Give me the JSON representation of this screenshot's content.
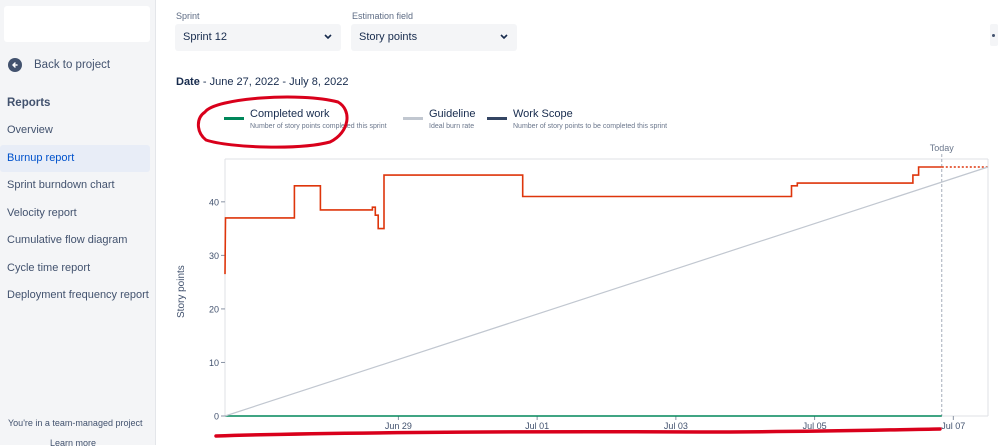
{
  "sidebar": {
    "back_label": "Back to project",
    "heading": "Reports",
    "items": [
      {
        "label": "Overview"
      },
      {
        "label": "Burnup report"
      },
      {
        "label": "Sprint burndown chart"
      },
      {
        "label": "Velocity report"
      },
      {
        "label": "Cumulative flow diagram"
      },
      {
        "label": "Cycle time report"
      },
      {
        "label": "Deployment frequency report"
      }
    ],
    "active_item": "Burnup report",
    "footer_line1": "You're in a team-managed project",
    "footer_line2": "Learn more"
  },
  "filters": {
    "sprint_label": "Sprint",
    "sprint_value": "Sprint 12",
    "estimation_label": "Estimation field",
    "estimation_value": "Story points"
  },
  "date": {
    "label": "Date",
    "range": " - June 27, 2022 - July 8, 2022"
  },
  "legend": [
    {
      "title": "Completed work",
      "description": "Number of story points completed this sprint",
      "color": "#00875a"
    },
    {
      "title": "Guideline",
      "description": "Ideal burn rate",
      "color": "#c1c7d0"
    },
    {
      "title": "Work Scope",
      "description": "Number of story points to be completed this sprint",
      "color": "#344563"
    }
  ],
  "annotation_color": "#d9001b",
  "chart_data": {
    "type": "line",
    "ylabel": "Story points",
    "ylim": [
      0,
      48
    ],
    "yticks": [
      0,
      10,
      20,
      30,
      40
    ],
    "xlim": [
      "2022-06-27",
      "2022-07-08"
    ],
    "xticks": [
      "Jun 29",
      "Jul 01",
      "Jul 03",
      "Jul 05",
      "Jul 07"
    ],
    "today_label": "Today",
    "today_date": "2022-07-07",
    "series": [
      {
        "name": "Work Scope",
        "color": "#de350b",
        "points": [
          [
            "2022-06-27T00:00",
            26.5
          ],
          [
            "2022-06-27T00:10",
            37
          ],
          [
            "2022-06-28T00:00",
            37
          ],
          [
            "2022-06-28T00:00",
            43
          ],
          [
            "2022-06-28T09:00",
            43
          ],
          [
            "2022-06-28T09:00",
            38.5
          ],
          [
            "2022-06-29T03:00",
            38.5
          ],
          [
            "2022-06-29T03:00",
            39
          ],
          [
            "2022-06-29T04:00",
            39
          ],
          [
            "2022-06-29T04:00",
            37.5
          ],
          [
            "2022-06-29T05:00",
            37.5
          ],
          [
            "2022-06-29T05:00",
            35
          ],
          [
            "2022-06-29T07:00",
            35
          ],
          [
            "2022-06-29T07:00",
            45
          ],
          [
            "2022-07-01T07:00",
            45
          ],
          [
            "2022-07-01T07:00",
            41
          ],
          [
            "2022-07-05T04:00",
            41
          ],
          [
            "2022-07-05T04:00",
            43
          ],
          [
            "2022-07-05T06:00",
            43
          ],
          [
            "2022-07-05T06:00",
            43.5
          ],
          [
            "2022-07-06T22:00",
            43.5
          ],
          [
            "2022-07-06T22:00",
            45
          ],
          [
            "2022-07-07T00:00",
            45
          ],
          [
            "2022-07-07T00:00",
            46.5
          ],
          [
            "2022-07-07T08:00",
            46.5
          ]
        ],
        "projection": [
          [
            "2022-07-07T08:00",
            46.5
          ],
          [
            "2022-07-08T00:00",
            46.5
          ]
        ]
      },
      {
        "name": "Completed work",
        "color": "#00875a",
        "points": [
          [
            "2022-06-27T00:00",
            0
          ],
          [
            "2022-07-07T08:00",
            0
          ]
        ]
      },
      {
        "name": "Guideline",
        "color": "#c1c7d0",
        "points": [
          [
            "2022-06-27T00:00",
            0
          ],
          [
            "2022-07-08T00:00",
            46.5
          ]
        ]
      }
    ]
  }
}
